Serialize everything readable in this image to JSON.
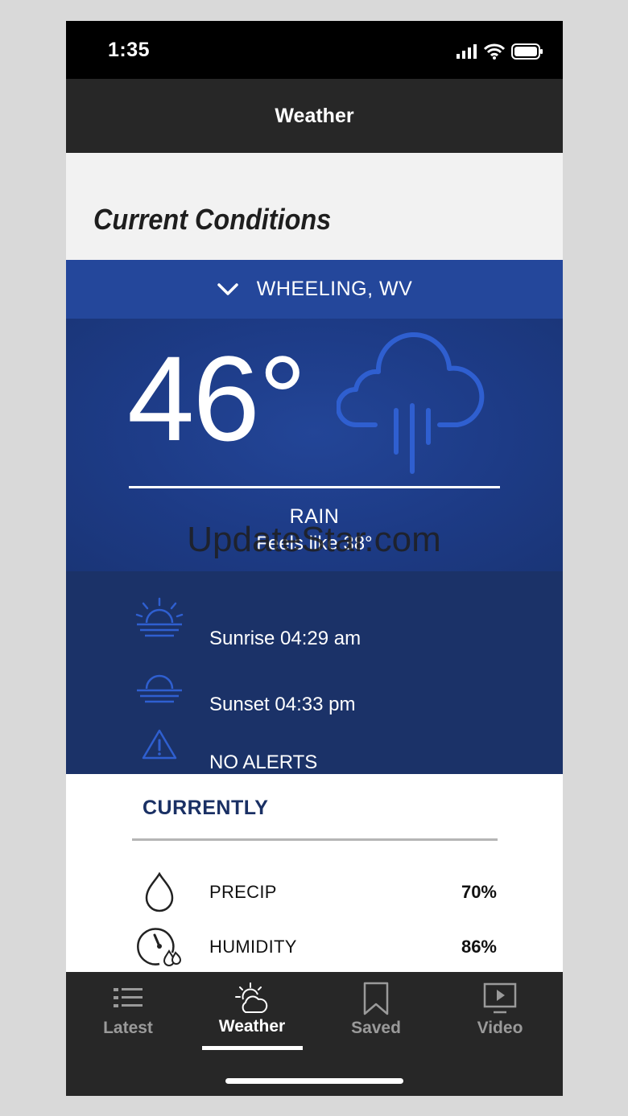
{
  "status_bar": {
    "time": "1:35"
  },
  "header": {
    "title": "Weather"
  },
  "section": {
    "title": "Current Conditions"
  },
  "location": {
    "name": "WHEELING, WV"
  },
  "hero": {
    "temperature": "46°",
    "condition": "RAIN",
    "feels_like": "Feels like 38°",
    "icon": "rain-cloud-icon"
  },
  "watermark": "UpdateStar.com",
  "info": [
    {
      "icon": "sunrise-icon",
      "text": "Sunrise 04:29 am"
    },
    {
      "icon": "sunset-icon",
      "text": "Sunset 04:33 pm"
    },
    {
      "icon": "alert-icon",
      "text": "NO ALERTS"
    }
  ],
  "currently": {
    "title": "CURRENTLY",
    "metrics": [
      {
        "icon": "droplet-icon",
        "label": "PRECIP",
        "value": "70%"
      },
      {
        "icon": "humidity-gauge-icon",
        "label": "HUMIDITY",
        "value": "86%"
      }
    ]
  },
  "tabs": [
    {
      "icon": "list-icon",
      "label": "Latest"
    },
    {
      "icon": "sun-cloud-icon",
      "label": "Weather",
      "active": true
    },
    {
      "icon": "bookmark-icon",
      "label": "Saved"
    },
    {
      "icon": "video-icon",
      "label": "Video"
    }
  ],
  "colors": {
    "accent_blue": "#24479b",
    "hero_blue": "#1d3b86",
    "panel_blue": "#1b3268",
    "icon_blue": "#2f5fd0",
    "header_dark": "#272727"
  }
}
